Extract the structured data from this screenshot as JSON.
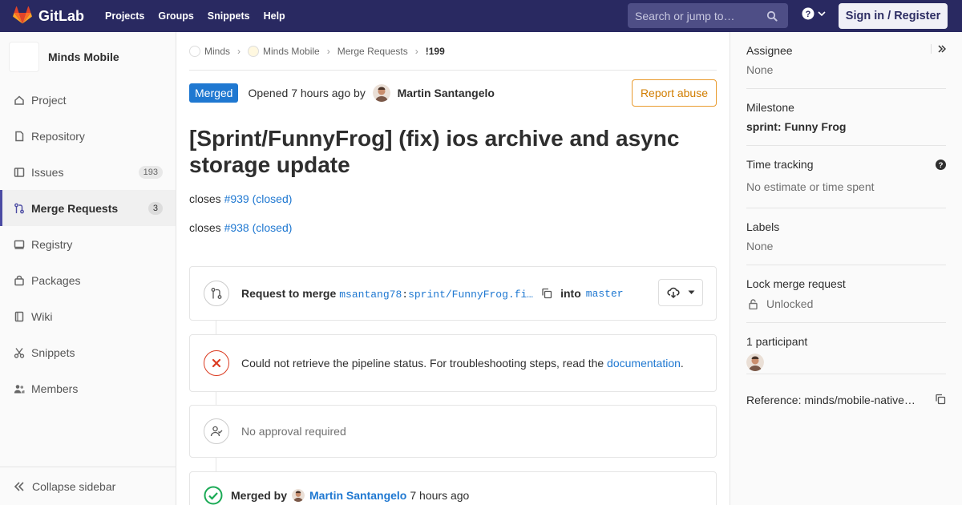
{
  "topnav": {
    "brand": "GitLab",
    "links": [
      "Projects",
      "Groups",
      "Snippets",
      "Help"
    ],
    "search_placeholder": "Search or jump to…",
    "signin": "Sign in / Register",
    "colors": {
      "bar": "#292961",
      "search": "#4e4e86"
    }
  },
  "sidebar": {
    "project_name": "Minds Mobile",
    "items": [
      {
        "label": "Project",
        "icon": "home-icon"
      },
      {
        "label": "Repository",
        "icon": "document-icon"
      },
      {
        "label": "Issues",
        "icon": "issues-icon",
        "badge": "193"
      },
      {
        "label": "Merge Requests",
        "icon": "merge-request-icon",
        "badge": "3"
      },
      {
        "label": "Registry",
        "icon": "container-icon"
      },
      {
        "label": "Packages",
        "icon": "package-icon"
      },
      {
        "label": "Wiki",
        "icon": "book-icon"
      },
      {
        "label": "Snippets",
        "icon": "scissors-icon"
      },
      {
        "label": "Members",
        "icon": "users-icon"
      }
    ],
    "collapse": "Collapse sidebar"
  },
  "breadcrumb": [
    "Minds",
    "Minds Mobile",
    "Merge Requests",
    "!199"
  ],
  "mr": {
    "status": "Merged",
    "opened_prefix": "Opened",
    "opened_time": "7 hours ago",
    "by": "by",
    "author": "Martin Santangelo",
    "report": "Report abuse",
    "title": "[Sprint/FunnyFrog] (fix) ios archive and async storage update",
    "closes": [
      {
        "prefix": "closes",
        "link": "#939 (closed)"
      },
      {
        "prefix": "closes",
        "link": "#938 (closed)"
      }
    ]
  },
  "merge_widget": {
    "prefix": "Request to merge",
    "source_user": "msantang78",
    "colon": ":",
    "source_branch": "sprint/FunnyFrog.fi…",
    "into": "into",
    "target": "master"
  },
  "pipeline": {
    "text": "Could not retrieve the pipeline status. For troubleshooting steps, read the",
    "link": "documentation",
    "period": "."
  },
  "approval": {
    "text": "No approval required"
  },
  "merged": {
    "prefix": "Merged by",
    "author": "Martin Santangelo",
    "time": "7 hours ago"
  },
  "right_sidebar": {
    "assignee": {
      "title": "Assignee",
      "value": "None"
    },
    "milestone": {
      "title": "Milestone",
      "value": "sprint: Funny Frog"
    },
    "time_tracking": {
      "title": "Time tracking",
      "value": "No estimate or time spent"
    },
    "labels": {
      "title": "Labels",
      "value": "None"
    },
    "lock": {
      "title": "Lock merge request",
      "value": "Unlocked"
    },
    "participants": {
      "title": "1 participant"
    },
    "reference": {
      "text": "Reference: minds/mobile-native…"
    }
  }
}
